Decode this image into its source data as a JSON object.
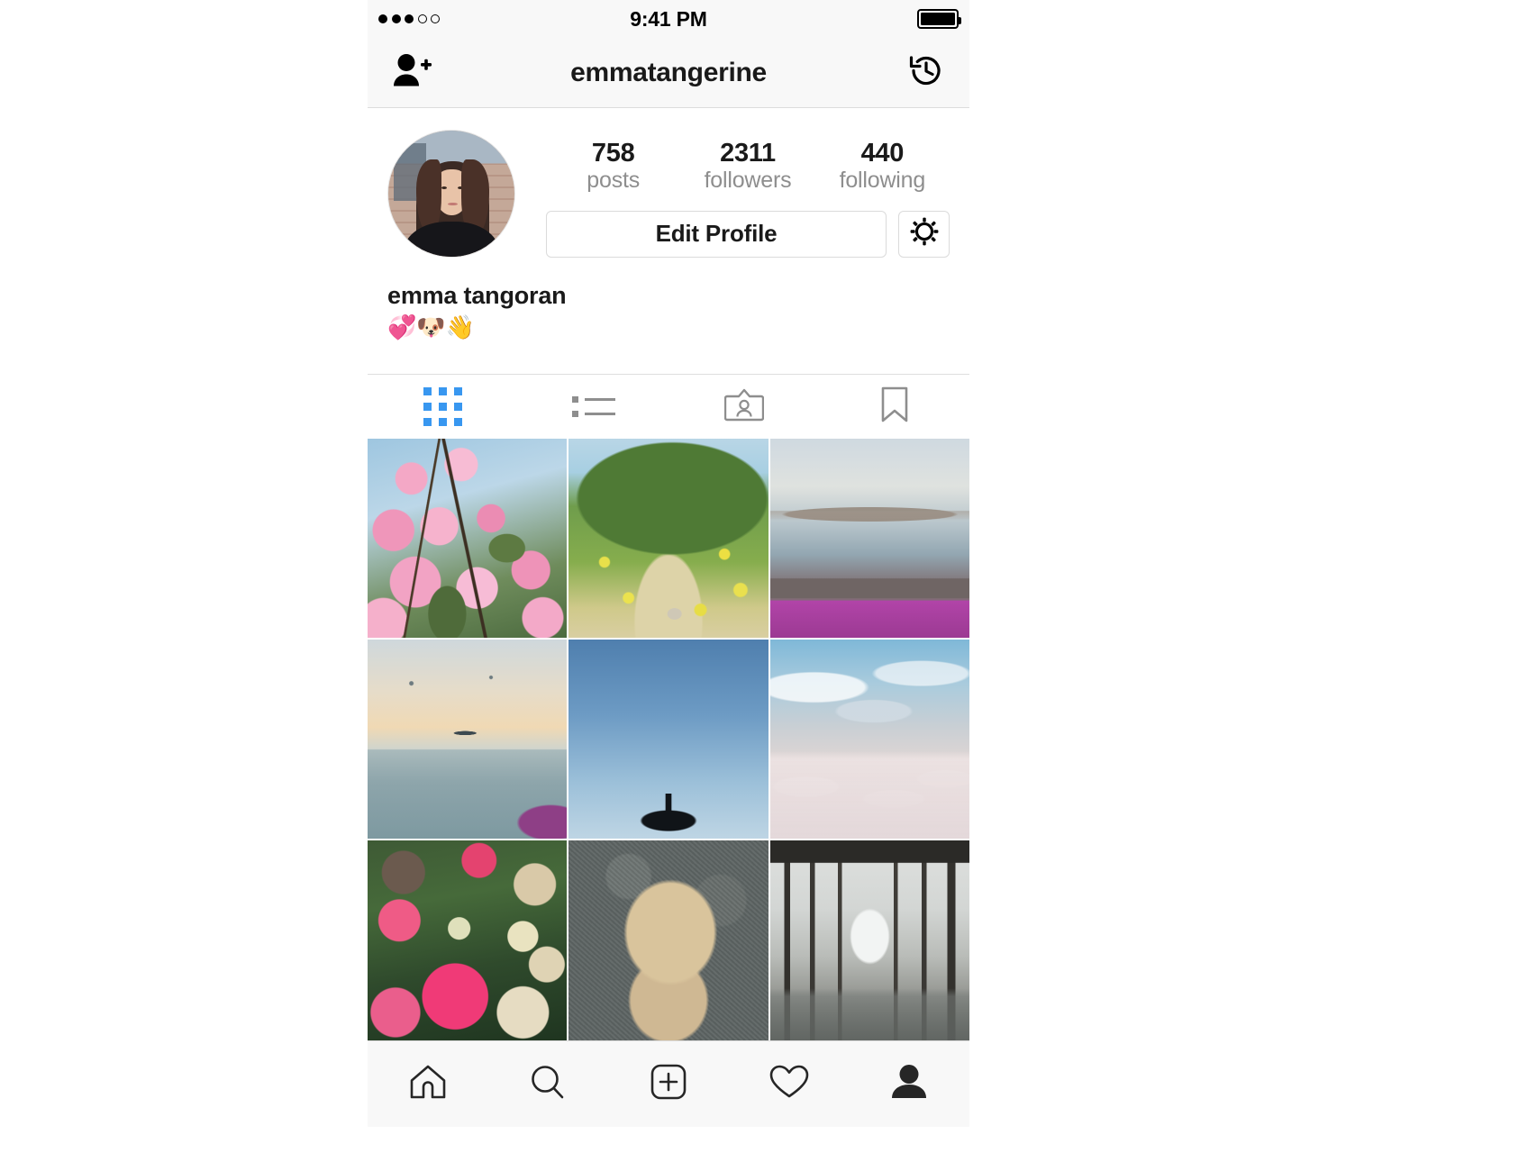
{
  "status_bar": {
    "signal_dots": [
      "filled",
      "filled",
      "filled",
      "empty",
      "empty"
    ],
    "time": "9:41 PM",
    "battery_icon": "battery-full-icon"
  },
  "nav_bar": {
    "add_person_icon": "add-person-icon",
    "title": "emmatangerine",
    "history_icon": "history-clock-icon"
  },
  "profile": {
    "avatar_alt": "avatar",
    "stats": [
      {
        "value": "758",
        "label": "posts"
      },
      {
        "value": "2311",
        "label": "followers"
      },
      {
        "value": "440",
        "label": "following"
      }
    ],
    "edit_profile_label": "Edit Profile",
    "settings_icon": "gear-icon",
    "display_name": "emma tangoran",
    "bio": "💞🐶👋"
  },
  "tabs": [
    {
      "name": "grid",
      "icon": "grid-icon",
      "active": true
    },
    {
      "name": "list",
      "icon": "list-icon",
      "active": false
    },
    {
      "name": "tagged-photos",
      "icon": "photo-of-you-icon",
      "active": false
    },
    {
      "name": "saved",
      "icon": "bookmark-icon",
      "active": false
    }
  ],
  "active_tab_color": "#3897f0",
  "inactive_icon_color": "#8e8e8e",
  "photo_grid": [
    {
      "id": 1,
      "alt": "pink cherry blossoms against blue sky"
    },
    {
      "id": 2,
      "alt": "green hillside trail with yellow wildflowers and a dog"
    },
    {
      "id": 3,
      "alt": "San Francisco bay view with purple ice plant"
    },
    {
      "id": 4,
      "alt": "seagull flying over ocean at sunset"
    },
    {
      "id": 5,
      "alt": "palm tree silhouette against blue sky"
    },
    {
      "id": 6,
      "alt": "clouds seen from above an airplane"
    },
    {
      "id": 7,
      "alt": "bouquet of pink peonies and proteas"
    },
    {
      "id": 8,
      "alt": "terrier dog looking up from pavement"
    },
    {
      "id": 9,
      "alt": "view underneath a wooden pier"
    }
  ],
  "bottom_nav": [
    {
      "name": "home",
      "icon": "home-icon",
      "active": false
    },
    {
      "name": "search",
      "icon": "search-icon",
      "active": false
    },
    {
      "name": "add-post",
      "icon": "plus-square-icon",
      "active": false
    },
    {
      "name": "activity",
      "icon": "heart-icon",
      "active": false
    },
    {
      "name": "profile",
      "icon": "person-filled-icon",
      "active": true
    }
  ]
}
